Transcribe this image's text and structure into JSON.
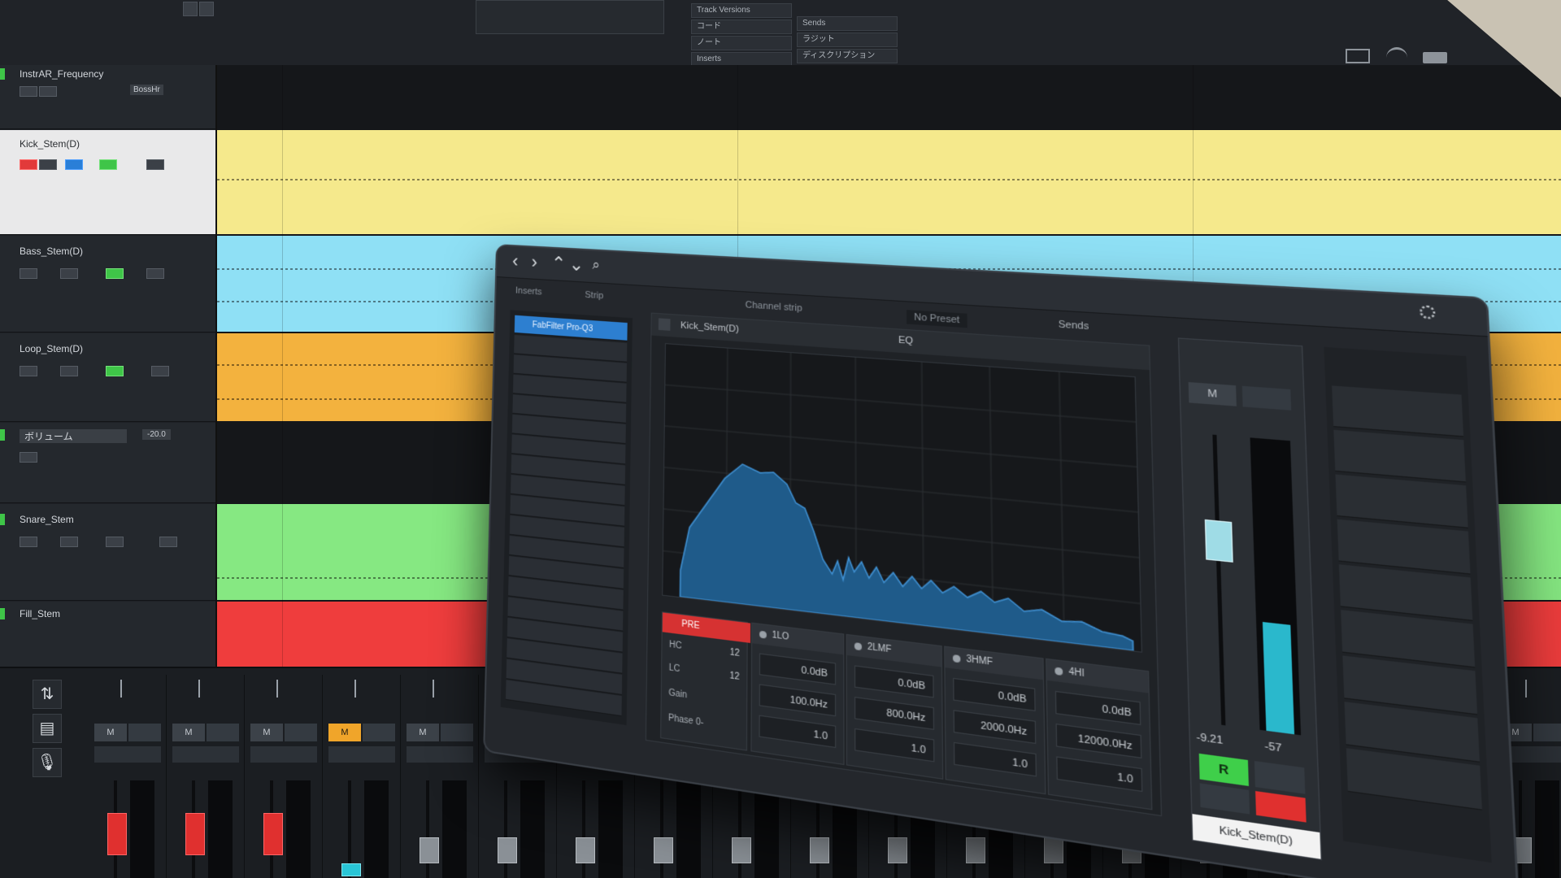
{
  "toolbar": {
    "menu_items": [
      "Track Versions",
      "コード",
      "ノート",
      "Sends",
      "ラジット",
      "Inserts",
      "ディスクリプション"
    ],
    "status_icons": [
      "mail-icon",
      "wifi-icon",
      "battery-icon",
      "gear-icon"
    ]
  },
  "tracks": [
    {
      "name": "InstrAR_Frequency",
      "tag": "BossHr",
      "color": "#3fc548",
      "selected": false
    },
    {
      "name": "Kick_Stem(D)",
      "color": "#f5e98c",
      "selected": true
    },
    {
      "name": "Bass_Stem(D)",
      "color": "#8fe0f5",
      "selected": false
    },
    {
      "name": "Loop_Stem(D)",
      "color": "#f3b23e",
      "selected": false
    },
    {
      "name": "ボリューム",
      "tag": "-20.0",
      "color": "#3fc548",
      "selected": false
    },
    {
      "name": "Snare_Stem",
      "color": "#86e882",
      "selected": false
    },
    {
      "name": "Fill_Stem",
      "color": "#ef3d3d",
      "selected": false
    }
  ],
  "plugin": {
    "tab_inserts": "Inserts",
    "tab_strip": "Strip",
    "section_label": "Channel strip",
    "preset_label": "No Preset",
    "insert_slot": "FabFilter Pro-Q3",
    "eq_track": "Kick_Stem(D)",
    "eq_label": "EQ",
    "sends_label": "Sends",
    "filter_band": {
      "label": "PRE",
      "hc_label": "HC",
      "hc_value": "12",
      "lc_label": "LC",
      "lc_value": "12",
      "gain_label": "Gain",
      "phase_label": "Phase 0-"
    },
    "bands": [
      {
        "name": "1LO",
        "gain": "0.0dB",
        "freq": "100.0Hz",
        "q": "1.0"
      },
      {
        "name": "2LMF",
        "gain": "0.0dB",
        "freq": "800.0Hz",
        "q": "1.0"
      },
      {
        "name": "3HMF",
        "gain": "0.0dB",
        "freq": "2000.0Hz",
        "q": "1.0"
      },
      {
        "name": "4HI",
        "gain": "0.0dB",
        "freq": "12000.0Hz",
        "q": "1.0"
      }
    ],
    "channel_meter": "-9.21",
    "channel_peak": "-57",
    "read_button": "R",
    "channel_name": "Kick_Stem(D)"
  },
  "mixer": {
    "mute_label": "M",
    "channel_count": 19,
    "mixer_icons": [
      "swap-arrows-icon",
      "rack-icon",
      "microphone-icon"
    ]
  },
  "colors": {
    "yellow": "#f5e98c",
    "cyan": "#8fe0f5",
    "orange": "#f3b23e",
    "green": "#86e882",
    "red": "#ef3d3d",
    "accent_blue": "#2d7fd0"
  }
}
